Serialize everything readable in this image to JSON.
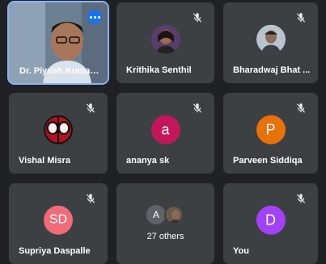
{
  "participants": [
    {
      "name": "Dr. Piyush Kumar...",
      "muted": false,
      "type": "video"
    },
    {
      "name": "Krithika Senthil",
      "muted": true,
      "type": "photo"
    },
    {
      "name": "Bharadwaj Bhat ...",
      "muted": true,
      "type": "photo"
    },
    {
      "name": "Vishal Misra",
      "muted": true,
      "type": "photo"
    },
    {
      "name": "ananya sk",
      "muted": true,
      "type": "letter",
      "initial": "a",
      "color": "#c2185b"
    },
    {
      "name": "Parveen Siddiqa",
      "muted": true,
      "type": "letter",
      "initial": "P",
      "color": "#e8710a"
    },
    {
      "name": "Supriya Daspalle",
      "muted": true,
      "type": "letter",
      "initial": "SD",
      "color": "#ef6c78"
    },
    {
      "name": "",
      "muted": false,
      "type": "others",
      "initial": "A",
      "label": "27 others"
    },
    {
      "name": "You",
      "muted": true,
      "type": "letter",
      "initial": "D",
      "color": "#a142f4"
    }
  ],
  "icons": {
    "mute": "mic-off-icon",
    "more": "more-options-icon"
  },
  "colors": {
    "background": "#202124",
    "tile": "#3c4043",
    "active_outline": "#8ab4f8",
    "menu_button": "#1a73e8"
  }
}
